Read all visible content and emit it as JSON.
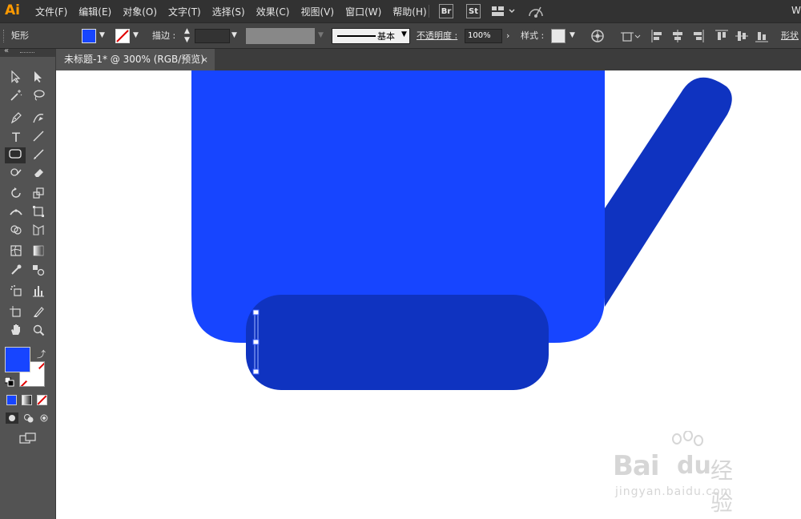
{
  "app": {
    "logo": "Ai"
  },
  "menu": [
    "文件(F)",
    "编辑(E)",
    "对象(O)",
    "文字(T)",
    "选择(S)",
    "效果(C)",
    "视图(V)",
    "窗口(W)",
    "帮助(H)"
  ],
  "menubar_badges": {
    "br": "Br",
    "st": "St"
  },
  "menubar_right_text": "W",
  "control_bar": {
    "object_type": "矩形",
    "stroke_label": "描边 :",
    "stroke_profile": "基本",
    "opacity_label": "不透明度 :",
    "opacity_value": "100%",
    "style_label": "样式 :",
    "shape_label": "形状"
  },
  "tab": {
    "title": "未标题-1* @ 300% (RGB/预览)",
    "close": "×"
  },
  "colors": {
    "fill": "#1745ff",
    "dark_blue": "#0f33c0",
    "menubar_bg": "#323232",
    "panel_bg": "#535353",
    "logo_orange": "#ff9a00"
  },
  "tools": [
    "selection-tool",
    "direct-selection-tool",
    "magic-wand-tool",
    "lasso-tool",
    "pen-tool",
    "curvature-tool",
    "type-tool",
    "line-tool",
    "rounded-rectangle-tool",
    "paintbrush-tool",
    "shaper-tool",
    "eraser-tool",
    "rotate-tool",
    "scale-tool",
    "width-tool",
    "free-transform-tool",
    "shape-builder-tool",
    "perspective-grid-tool",
    "mesh-tool",
    "gradient-tool",
    "eyedropper-tool",
    "blend-tool",
    "symbol-sprayer-tool",
    "column-graph-tool",
    "artboard-tool",
    "slice-tool",
    "hand-tool",
    "zoom-tool"
  ],
  "watermark": {
    "logo_text": "Bai",
    "logo_suffix": "du",
    "brand": "经验",
    "url": "jingyan.baidu.com"
  }
}
